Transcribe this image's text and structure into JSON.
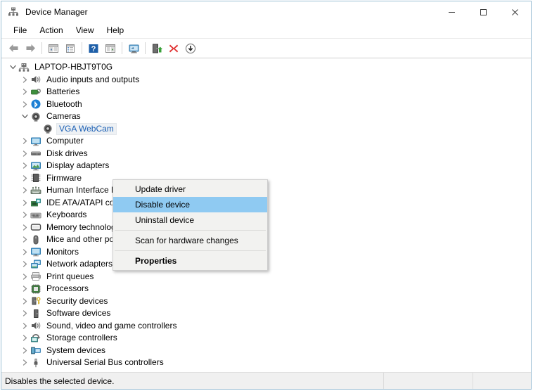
{
  "window": {
    "title": "Device Manager",
    "icon": "device-manager-icon",
    "controls": [
      {
        "name": "minimize-button",
        "glyph": "─"
      },
      {
        "name": "maximize-button",
        "glyph": "□"
      },
      {
        "name": "close-button",
        "glyph": "✕"
      }
    ]
  },
  "menubar": {
    "items": [
      {
        "label": "File",
        "name": "menubar-item-file"
      },
      {
        "label": "Action",
        "name": "menubar-item-action"
      },
      {
        "label": "View",
        "name": "menubar-item-view"
      },
      {
        "label": "Help",
        "name": "menubar-item-help"
      }
    ]
  },
  "toolbar": {
    "buttons": [
      {
        "name": "back-button",
        "icon": "back-arrow-icon"
      },
      {
        "name": "forward-button",
        "icon": "forward-arrow-icon"
      },
      {
        "name": "separator-1",
        "icon": "separator"
      },
      {
        "name": "show-hide-console-tree-button",
        "icon": "console-tree-icon"
      },
      {
        "name": "properties-button",
        "icon": "properties-icon"
      },
      {
        "name": "separator-2",
        "icon": "separator"
      },
      {
        "name": "help-button",
        "icon": "help-question-icon"
      },
      {
        "name": "show-hide-action-pane-button",
        "icon": "action-pane-icon"
      },
      {
        "name": "separator-3",
        "icon": "separator"
      },
      {
        "name": "scan-for-hardware-changes-button",
        "icon": "monitor-scan-icon"
      },
      {
        "name": "separator-4",
        "icon": "separator"
      },
      {
        "name": "update-driver-button",
        "icon": "update-driver-icon"
      },
      {
        "name": "uninstall-device-button",
        "icon": "red-x-icon"
      },
      {
        "name": "disable-device-button",
        "icon": "down-arrow-circle-icon"
      }
    ]
  },
  "tree": {
    "nodes": [
      {
        "label": "LAPTOP-HBJT9T0G",
        "level": 0,
        "twisty": "expanded",
        "icon": "computer-root-icon",
        "selected": false,
        "name": "tree-node-laptop-hbjt9t0g"
      },
      {
        "label": "Audio inputs and outputs",
        "level": 1,
        "twisty": "collapsed",
        "icon": "speaker-icon",
        "selected": false,
        "name": "tree-node-audio-inputs-and-outputs"
      },
      {
        "label": "Batteries",
        "level": 1,
        "twisty": "collapsed",
        "icon": "battery-icon",
        "selected": false,
        "name": "tree-node-batteries"
      },
      {
        "label": "Bluetooth",
        "level": 1,
        "twisty": "collapsed",
        "icon": "bluetooth-icon",
        "selected": false,
        "name": "tree-node-bluetooth"
      },
      {
        "label": "Cameras",
        "level": 1,
        "twisty": "expanded",
        "icon": "camera-icon",
        "selected": false,
        "name": "tree-node-cameras"
      },
      {
        "label": "VGA WebCam",
        "level": 2,
        "twisty": "none",
        "icon": "camera-icon",
        "selected": true,
        "name": "tree-node-vga-webcam"
      },
      {
        "label": "Computer",
        "level": 1,
        "twisty": "collapsed",
        "icon": "computer-icon",
        "selected": false,
        "name": "tree-node-computer"
      },
      {
        "label": "Disk drives",
        "level": 1,
        "twisty": "collapsed",
        "icon": "disk-drive-icon",
        "selected": false,
        "name": "tree-node-disk-drives"
      },
      {
        "label": "Display adapters",
        "level": 1,
        "twisty": "collapsed",
        "icon": "display-adapter-icon",
        "selected": false,
        "name": "tree-node-display-adapters"
      },
      {
        "label": "Firmware",
        "level": 1,
        "twisty": "collapsed",
        "icon": "firmware-chip-icon",
        "selected": false,
        "name": "tree-node-firmware"
      },
      {
        "label": "Human Interface Devices",
        "level": 1,
        "twisty": "collapsed",
        "icon": "human-interface-icon",
        "selected": false,
        "name": "tree-node-human-interface-devices"
      },
      {
        "label": "IDE ATA/ATAPI controllers",
        "level": 1,
        "twisty": "collapsed",
        "icon": "ide-controller-icon",
        "selected": false,
        "name": "tree-node-ide-ata-atapi-controllers"
      },
      {
        "label": "Keyboards",
        "level": 1,
        "twisty": "collapsed",
        "icon": "keyboard-icon",
        "selected": false,
        "name": "tree-node-keyboards"
      },
      {
        "label": "Memory technology devices",
        "level": 1,
        "twisty": "collapsed",
        "icon": "memory-technology-icon",
        "selected": false,
        "name": "tree-node-memory-technology-devices"
      },
      {
        "label": "Mice and other pointing devices",
        "level": 1,
        "twisty": "collapsed",
        "icon": "mouse-icon",
        "selected": false,
        "name": "tree-node-mice-and-other-pointing-devices"
      },
      {
        "label": "Monitors",
        "level": 1,
        "twisty": "collapsed",
        "icon": "monitor-icon",
        "selected": false,
        "name": "tree-node-monitors"
      },
      {
        "label": "Network adapters",
        "level": 1,
        "twisty": "collapsed",
        "icon": "network-adapter-icon",
        "selected": false,
        "name": "tree-node-network-adapters"
      },
      {
        "label": "Print queues",
        "level": 1,
        "twisty": "collapsed",
        "icon": "printer-icon",
        "selected": false,
        "name": "tree-node-print-queues"
      },
      {
        "label": "Processors",
        "level": 1,
        "twisty": "collapsed",
        "icon": "processor-icon",
        "selected": false,
        "name": "tree-node-processors"
      },
      {
        "label": "Security devices",
        "level": 1,
        "twisty": "collapsed",
        "icon": "security-device-icon",
        "selected": false,
        "name": "tree-node-security-devices"
      },
      {
        "label": "Software devices",
        "level": 1,
        "twisty": "collapsed",
        "icon": "software-device-icon",
        "selected": false,
        "name": "tree-node-software-devices"
      },
      {
        "label": "Sound, video and game controllers",
        "level": 1,
        "twisty": "collapsed",
        "icon": "speaker-icon",
        "selected": false,
        "name": "tree-node-sound-video-and-game-controllers"
      },
      {
        "label": "Storage controllers",
        "level": 1,
        "twisty": "collapsed",
        "icon": "storage-controller-icon",
        "selected": false,
        "name": "tree-node-storage-controllers"
      },
      {
        "label": "System devices",
        "level": 1,
        "twisty": "collapsed",
        "icon": "system-device-icon",
        "selected": false,
        "name": "tree-node-system-devices"
      },
      {
        "label": "Universal Serial Bus controllers",
        "level": 1,
        "twisty": "collapsed",
        "icon": "usb-icon",
        "selected": false,
        "name": "tree-node-universal-serial-bus-controllers"
      }
    ]
  },
  "context_menu": {
    "visible": true,
    "items": [
      {
        "type": "item",
        "label": "Update driver",
        "highlight": false,
        "bold": false,
        "name": "context-menu-item-update-driver"
      },
      {
        "type": "item",
        "label": "Disable device",
        "highlight": true,
        "bold": false,
        "name": "context-menu-item-disable-device"
      },
      {
        "type": "item",
        "label": "Uninstall device",
        "highlight": false,
        "bold": false,
        "name": "context-menu-item-uninstall-device"
      },
      {
        "type": "separator",
        "name": "context-menu-separator-1"
      },
      {
        "type": "item",
        "label": "Scan for hardware changes",
        "highlight": false,
        "bold": false,
        "name": "context-menu-item-scan-for-hardware-changes"
      },
      {
        "type": "separator",
        "name": "context-menu-separator-2"
      },
      {
        "type": "item",
        "label": "Properties",
        "highlight": false,
        "bold": true,
        "name": "context-menu-item-properties"
      }
    ]
  },
  "statusbar": {
    "message": "Disables the selected device."
  },
  "colors": {
    "menu_highlight": "#8fcaf2",
    "selection_text": "#1a5fb4",
    "window_border": "#9bbfd4",
    "menu_background": "#f2f2f0",
    "statusbar_background": "#f0f0f0"
  }
}
